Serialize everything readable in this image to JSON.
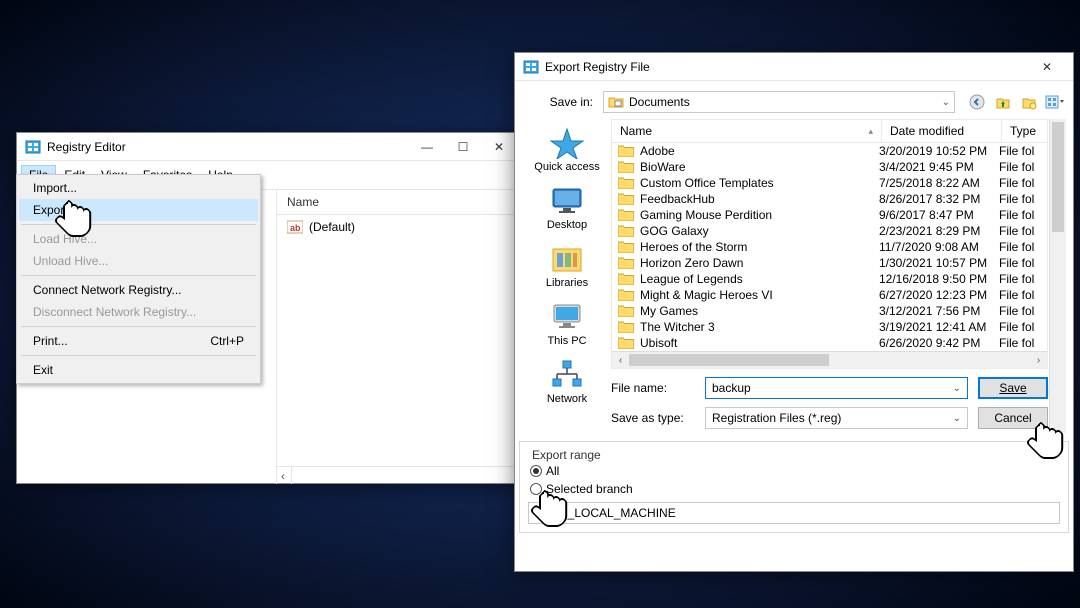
{
  "regedit": {
    "title": "Registry Editor",
    "menu": [
      "File",
      "Edit",
      "View",
      "Favorites",
      "Help"
    ],
    "file_menu": {
      "import": "Import...",
      "export": "Export...",
      "load_hive": "Load Hive...",
      "unload_hive": "Unload Hive...",
      "connect": "Connect Network Registry...",
      "disconnect": "Disconnect Network Registry...",
      "print": "Print...",
      "print_shortcut": "Ctrl+P",
      "exit": "Exit"
    },
    "right_pane": {
      "col_name": "Name",
      "default_value": "(Default)"
    }
  },
  "export": {
    "title": "Export Registry File",
    "save_in_label": "Save in:",
    "save_in_value": "Documents",
    "places": [
      "Quick access",
      "Desktop",
      "Libraries",
      "This PC",
      "Network"
    ],
    "columns": {
      "name": "Name",
      "date": "Date modified",
      "type": "Type"
    },
    "files": [
      {
        "name": "Adobe",
        "date": "3/20/2019 10:52 PM",
        "type": "File fol"
      },
      {
        "name": "BioWare",
        "date": "3/4/2021 9:45 PM",
        "type": "File fol"
      },
      {
        "name": "Custom Office Templates",
        "date": "7/25/2018 8:22 AM",
        "type": "File fol"
      },
      {
        "name": "FeedbackHub",
        "date": "8/26/2017 8:32 PM",
        "type": "File fol"
      },
      {
        "name": "Gaming Mouse Perdition",
        "date": "9/6/2017 8:47 PM",
        "type": "File fol"
      },
      {
        "name": "GOG Galaxy",
        "date": "2/23/2021 8:29 PM",
        "type": "File fol"
      },
      {
        "name": "Heroes of the Storm",
        "date": "11/7/2020 9:08 AM",
        "type": "File fol"
      },
      {
        "name": "Horizon Zero Dawn",
        "date": "1/30/2021 10:57 PM",
        "type": "File fol"
      },
      {
        "name": "League of Legends",
        "date": "12/16/2018 9:50 PM",
        "type": "File fol"
      },
      {
        "name": "Might & Magic Heroes VI",
        "date": "6/27/2020 12:23 PM",
        "type": "File fol"
      },
      {
        "name": "My Games",
        "date": "3/12/2021 7:56 PM",
        "type": "File fol"
      },
      {
        "name": "The Witcher 3",
        "date": "3/19/2021 12:41 AM",
        "type": "File fol"
      },
      {
        "name": "Ubisoft",
        "date": "6/26/2020 9:42 PM",
        "type": "File fol"
      }
    ],
    "filename_label": "File name:",
    "filename_value": "backup",
    "saveas_label": "Save as type:",
    "saveas_value": "Registration Files (*.reg)",
    "save_btn": "Save",
    "cancel_btn": "Cancel",
    "range_legend": "Export range",
    "range_all": "All",
    "range_selected": "Selected branch",
    "branch_value": "HKEY_LOCAL_MACHINE"
  }
}
